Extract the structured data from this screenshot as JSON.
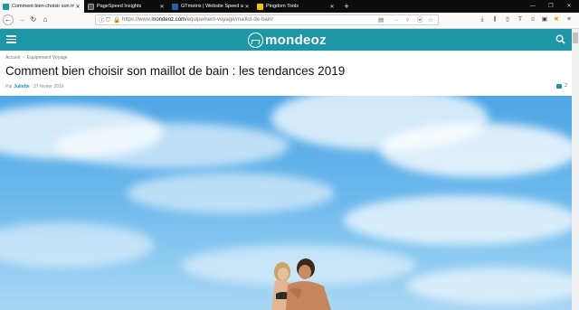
{
  "browser": {
    "tabs": [
      {
        "title": "Comment bien choisir son maillot de bain",
        "active": true,
        "icon": "mondeoz-favicon",
        "color": "#1d96a5"
      },
      {
        "title": "PageSpeed Insights",
        "active": false,
        "icon": "pagespeed-favicon",
        "color": "#444444"
      },
      {
        "title": "GTmetrix | Website Speed and Performance",
        "active": false,
        "icon": "gtmetrix-favicon",
        "color": "#2c5ea8"
      },
      {
        "title": "Pingdom Tools",
        "active": false,
        "icon": "pingdom-favicon",
        "color": "#f5c400"
      }
    ],
    "url_prefix": "https://www.",
    "url_domain": "mondeoz.com",
    "url_path": "/equipement-voyage/maillot-de-bain/"
  },
  "site": {
    "logo_text": "mondeoz",
    "brand_color": "#1d96a5"
  },
  "article": {
    "breadcrumb_home": "Accueil",
    "breadcrumb_section": "Equipement Voyage",
    "title": "Comment bien choisir son maillot de bain : les tendances 2019",
    "by": "Par",
    "author": "Juliette",
    "date": "· 27 février 2019",
    "comment_count": "2"
  }
}
